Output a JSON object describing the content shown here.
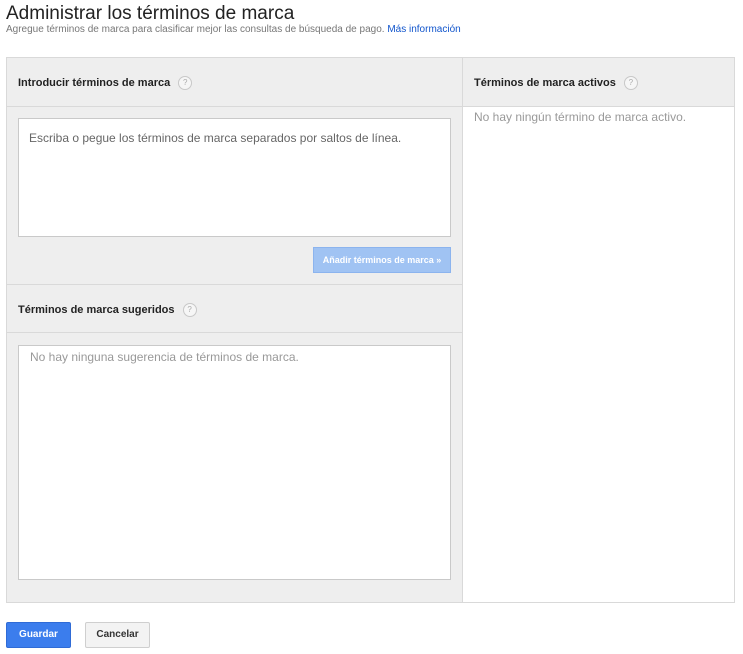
{
  "header": {
    "title": "Administrar los términos de marca",
    "subtitle": "Agregue términos de marca para clasificar mejor las consultas de búsqueda de pago.",
    "learn_more": "Más información"
  },
  "enter_section": {
    "label": "Introducir términos de marca",
    "help": "?",
    "placeholder": "Escriba o pegue los términos de marca separados por saltos de línea.",
    "add_button": "Añadir términos de marca »"
  },
  "suggested_section": {
    "label": "Términos de marca sugeridos",
    "help": "?",
    "empty": "No hay ninguna sugerencia de términos de marca."
  },
  "active_section": {
    "label": "Términos de marca activos",
    "help": "?",
    "empty": "No hay ningún término de marca activo."
  },
  "footer": {
    "save": "Guardar",
    "cancel": "Cancelar"
  },
  "colors": {
    "primary": "#3b7ded",
    "disabled_button": "#a0c3f3",
    "link": "#1155cc",
    "panel_bg": "#eeeeee"
  }
}
